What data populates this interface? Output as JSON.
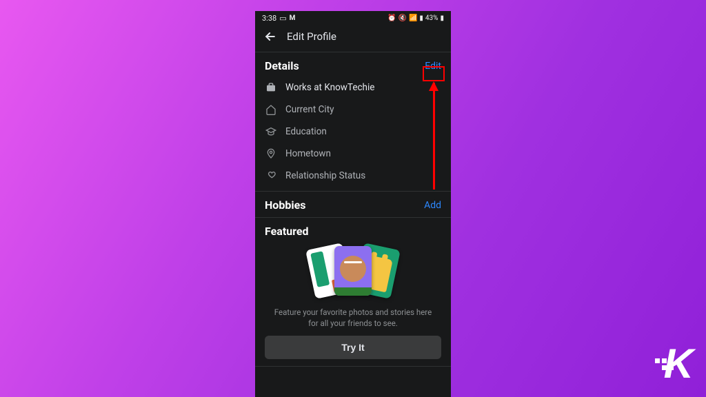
{
  "statusbar": {
    "time": "3:38",
    "battery": "43%"
  },
  "appbar": {
    "title": "Edit Profile"
  },
  "details": {
    "title": "Details",
    "edit": "Edit",
    "items": [
      {
        "label": "Works at KnowTechie",
        "bright": true
      },
      {
        "label": "Current City",
        "bright": false
      },
      {
        "label": "Education",
        "bright": false
      },
      {
        "label": "Hometown",
        "bright": false
      },
      {
        "label": "Relationship Status",
        "bright": false
      }
    ]
  },
  "hobbies": {
    "title": "Hobbies",
    "action": "Add"
  },
  "featured": {
    "title": "Featured",
    "desc1": "Feature your favorite photos and stories here",
    "desc2": "for all your friends to see.",
    "button": "Try It"
  }
}
